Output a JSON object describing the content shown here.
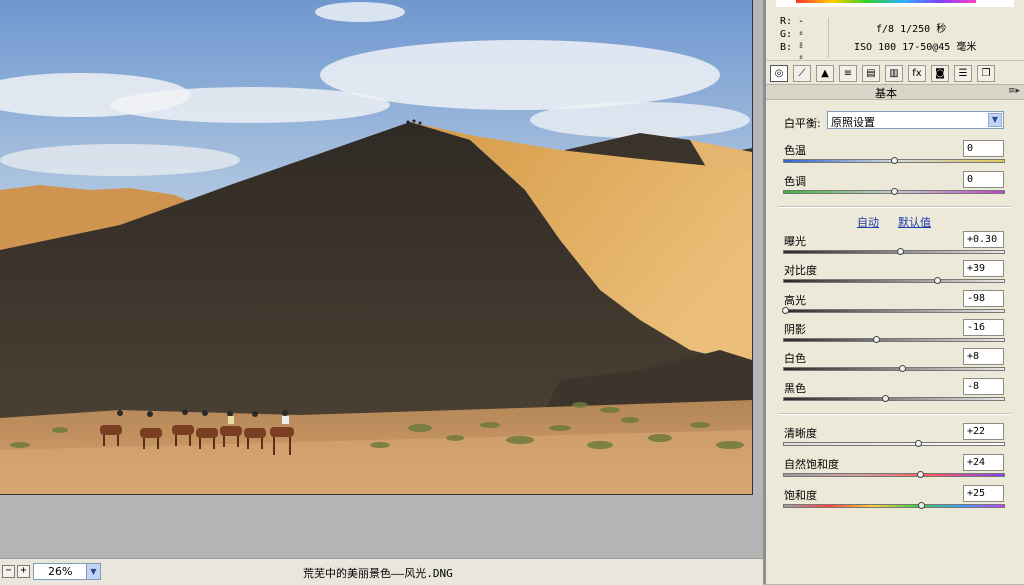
{
  "readout": {
    "r_label": "R:",
    "g_label": "G:",
    "b_label": "B:",
    "r": "---",
    "g": "---",
    "b": "---",
    "exif_line1": "f/8  1/250 秒",
    "exif_line2": "ISO 100  17-50@45 毫米"
  },
  "tabs": [
    {
      "icon": "aperture-icon",
      "glyph": "◎"
    },
    {
      "icon": "tone-curve-icon",
      "glyph": "⟋"
    },
    {
      "icon": "detail-icon",
      "glyph": "▲"
    },
    {
      "icon": "hsl-icon",
      "glyph": "≡"
    },
    {
      "icon": "split-toning-icon",
      "glyph": "▤"
    },
    {
      "icon": "lens-correction-icon",
      "glyph": "▥"
    },
    {
      "icon": "fx-icon",
      "glyph": "fx"
    },
    {
      "icon": "camera-calibration-icon",
      "glyph": "◙"
    },
    {
      "icon": "presets-icon",
      "glyph": "☰"
    },
    {
      "icon": "snapshots-icon",
      "glyph": "❐"
    }
  ],
  "section": {
    "title": "基本",
    "menu_glyph": "≡▸"
  },
  "white_balance": {
    "label": "白平衡:",
    "value": "原照设置"
  },
  "sliders": {
    "temperature": {
      "label": "色温",
      "value": "0",
      "level": 0.5
    },
    "tint": {
      "label": "色调",
      "value": "0",
      "level": 0.5
    },
    "exposure": {
      "label": "曝光",
      "value": "+0.30",
      "level": 0.53
    },
    "contrast": {
      "label": "对比度",
      "value": "+39",
      "level": 0.695
    },
    "highlights": {
      "label": "高光",
      "value": "-98",
      "level": 0.01
    },
    "shadows": {
      "label": "阴影",
      "value": "-16",
      "level": 0.42
    },
    "whites": {
      "label": "白色",
      "value": "+8",
      "level": 0.54
    },
    "blacks": {
      "label": "黑色",
      "value": "-8",
      "level": 0.46
    },
    "clarity": {
      "label": "清晰度",
      "value": "+22",
      "level": 0.61
    },
    "vibrance": {
      "label": "自然饱和度",
      "value": "+24",
      "level": 0.62
    },
    "saturation": {
      "label": "饱和度",
      "value": "+25",
      "level": 0.625
    }
  },
  "links": {
    "auto": "自动",
    "default": "默认值"
  },
  "status": {
    "zoom_out": "−",
    "zoom_in": "+",
    "zoom": "26%",
    "filename": "荒芜中的美丽景色——风光.DNG"
  },
  "colors": {
    "panel_bg": "#ece9d8",
    "link": "#1c3aa9",
    "sky": "#7ea5d6",
    "sand_lit": "#e0a95a",
    "sand_shadow": "#3c352d"
  }
}
